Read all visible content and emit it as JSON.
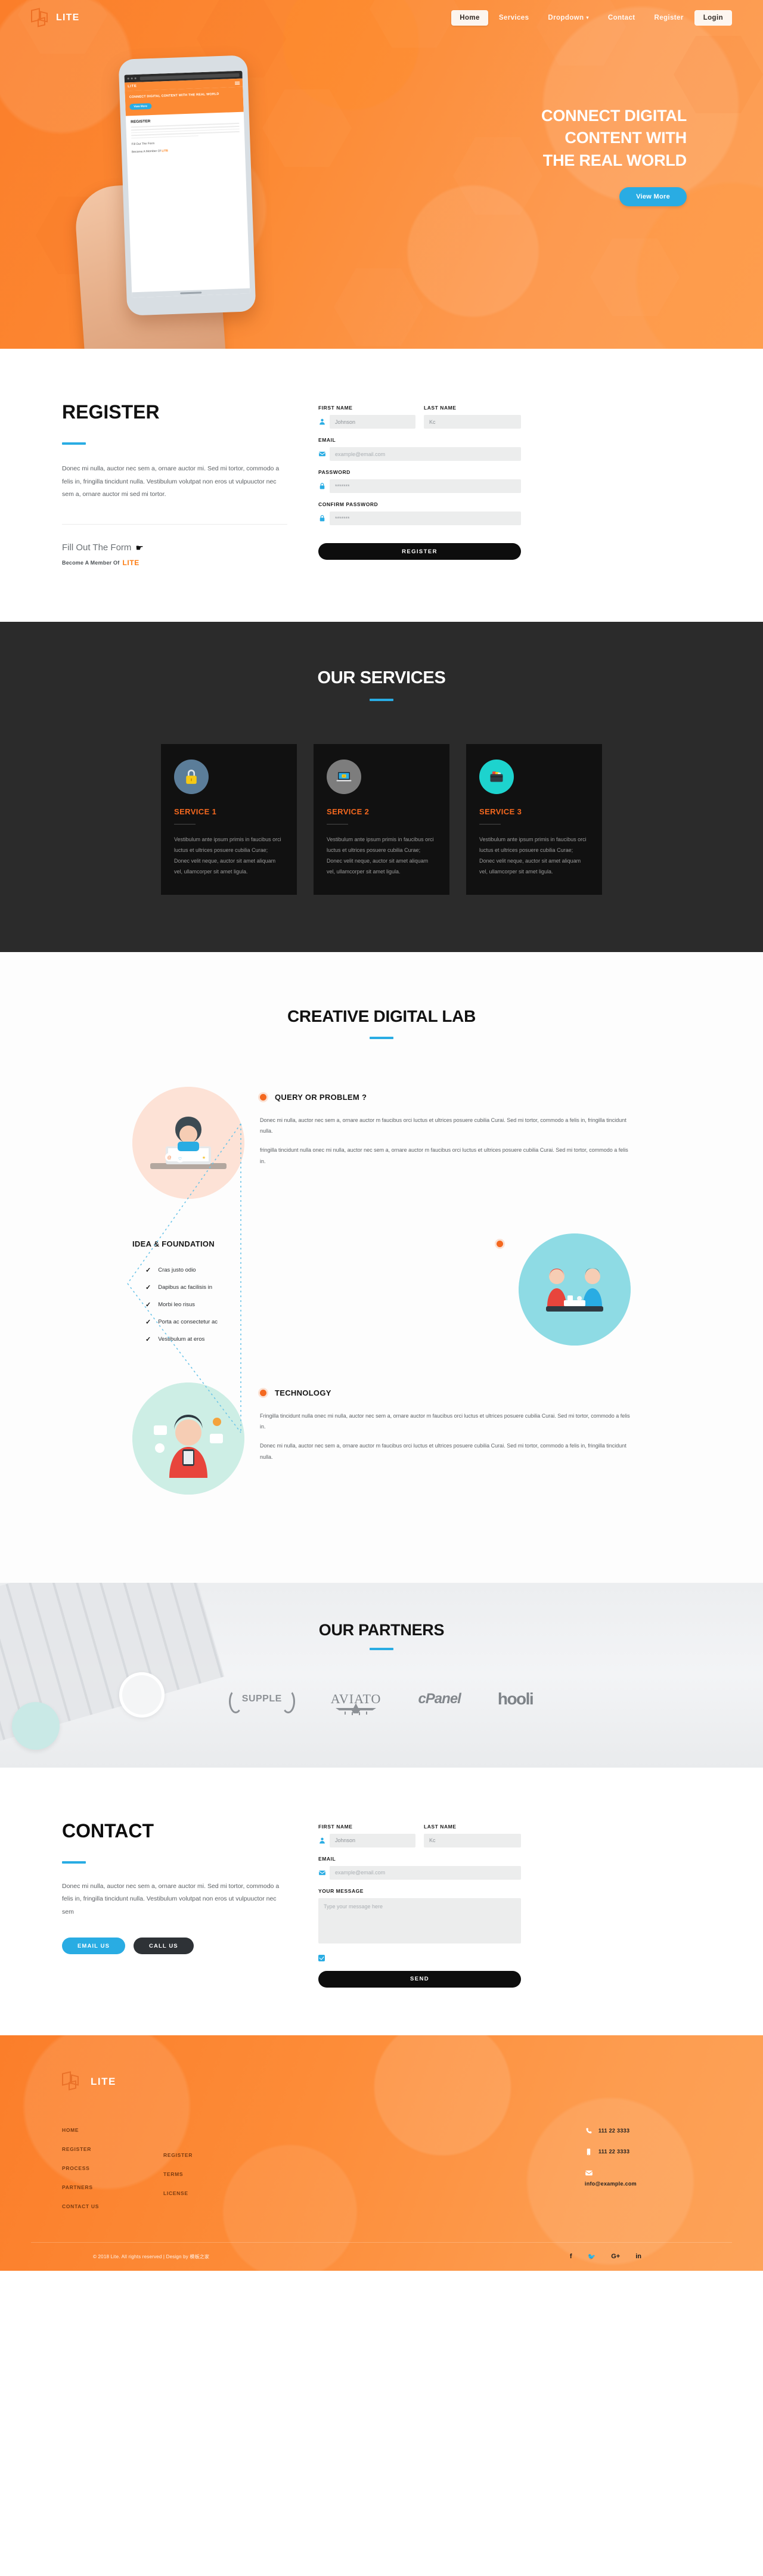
{
  "brand": {
    "name": "LITE",
    "logo_icon": "laravel-mark-icon"
  },
  "nav": {
    "items": [
      {
        "label": "Home",
        "active": true
      },
      {
        "label": "Services",
        "active": false
      },
      {
        "label": "Dropdown",
        "caret": "▾",
        "active": false
      },
      {
        "label": "Contact",
        "active": false
      },
      {
        "label": "Register",
        "active": false
      },
      {
        "label": "Login",
        "outline": true
      }
    ]
  },
  "hero": {
    "title_lines": [
      "CONNECT DIGITAL",
      "CONTENT WITH",
      "THE REAL WORLD"
    ],
    "button": "View More",
    "accent": "#29ace3",
    "background": "#fc8a34",
    "phone": {
      "logo": "LITE",
      "hero_text": "CONNECT DIGITAL CONTENT WITH THE REAL WORLD",
      "hero_button": "View More",
      "section_title": "REGISTER",
      "fill_text": "Fill Out The Form",
      "member_text": "Become A Member Of",
      "member_brand": "LITE"
    }
  },
  "register": {
    "title": "REGISTER",
    "paragraph": "Donec mi nulla, auctor nec sem a, ornare auctor mi. Sed mi tortor, commodo a felis in, fringilla tincidunt nulla. Vestibulum volutpat non eros ut vulpuuctor nec sem a, ornare auctor mi sed mi tortor.",
    "fill_out": "Fill Out The Form",
    "fill_icon": "pointing-hand-icon",
    "member_prefix": "Become A Member Of",
    "member_brand": "LITE",
    "fields": {
      "first_name_label": "FIRST NAME",
      "first_name_value": "Johnson",
      "last_name_label": "LAST NAME",
      "last_name_value": "Kc",
      "email_label": "EMAIL",
      "email_placeholder": "example@email.com",
      "password_label": "PASSWORD",
      "password_value": "*******",
      "confirm_label": "CONFIRM PASSWORD",
      "confirm_value": "*******"
    },
    "submit": "REGISTER"
  },
  "services": {
    "title": "OUR SERVICES",
    "cards": [
      {
        "icon": "padlock-icon",
        "icon_bg": "#5b7d99",
        "title": "SERVICE 1",
        "text": "Vestibulum ante ipsum primis in faucibus orci luctus et ultrices posuere cubilia Curae; Donec velit neque, auctor sit amet aliquam vel, ullamcorper sit amet ligula."
      },
      {
        "icon": "laptop-icon",
        "icon_bg": "#7d7d7d",
        "title": "SERVICE 2",
        "text": "Vestibulum ante ipsum primis in faucibus orci luctus et ultrices posuere cubilia Curae; Donec velit neque, auctor sit amet aliquam vel, ullamcorper sit amet ligula."
      },
      {
        "icon": "wallet-icon",
        "icon_bg": "#1dd3ce",
        "title": "SERVICE 3",
        "text": "Vestibulum ante ipsum primis in faucibus orci luctus et ultrices posuere cubilia Curae; Donec velit neque, auctor sit amet aliquam vel, ullamcorper sit amet ligula."
      }
    ]
  },
  "lab": {
    "title": "CREATIVE DIGITAL LAB",
    "blocks": [
      {
        "heading": "QUERY OR PROBLEM ?",
        "illustration": "woman-at-laptop-icon",
        "paragraphs": [
          "Donec mi nulla, auctor nec sem a, ornare auctor m faucibus orci luctus et ultrices posuere cubilia Curai. Sed mi tortor, commodo a felis in, fringilla tincidunt nulla.",
          "fringilla tincidunt nulla onec mi nulla, auctor nec sem a, ornare auctor m faucibus orci luctus et ultrices posuere cubilia Curai. Sed mi tortor, commodo a felis in."
        ]
      },
      {
        "heading": "IDEA & FOUNDATION",
        "illustration": "two-people-meeting-icon",
        "items": [
          "Cras justo odio",
          "Dapibus ac facilisis in",
          "Morbi leo risus",
          "Porta ac consectetur ac",
          "Vestibulum at eros"
        ]
      },
      {
        "heading": "TECHNOLOGY",
        "illustration": "woman-with-phone-icon",
        "paragraphs": [
          "Fringilla tincidunt nulla onec mi nulla, auctor nec sem a, ornare auctor m faucibus orci luctus et ultrices posuere cubilia Curai. Sed mi tortor, commodo a felis in.",
          "Donec mi nulla, auctor nec sem a, ornare auctor m faucibus orci luctus et ultrices posuere cubilia Curai. Sed mi tortor, commodo a felis in, fringilla tincidunt nulla."
        ]
      }
    ]
  },
  "partners": {
    "title": "OUR PARTNERS",
    "logos": [
      "SUPPLE",
      "AVIATO",
      "cPanel",
      "hooli"
    ]
  },
  "contact": {
    "title": "CONTACT",
    "paragraph": "Donec mi nulla, auctor nec sem a, ornare auctor mi. Sed mi tortor, commodo a felis in, fringilla tincidunt nulla. Vestibulum volutpat non eros ut vulpuuctor nec sem",
    "email_button": "EMAIL US",
    "call_button": "CALL US",
    "fields": {
      "first_name_label": "FIRST NAME",
      "first_name_value": "Johnson",
      "last_name_label": "LAST NAME",
      "last_name_value": "Kc",
      "email_label": "EMAIL",
      "email_placeholder": "example@email.com",
      "message_label": "YOUR MESSAGE",
      "message_placeholder": "Type your message here"
    },
    "submit": "SEND"
  },
  "footer": {
    "brand": "LITE",
    "col1": [
      "HOME",
      "REGISTER",
      "PROCESS",
      "PARTNERS",
      "CONTACT US"
    ],
    "col2": [
      "REGISTER",
      "TERMS",
      "LICENSE"
    ],
    "contact": [
      {
        "icon": "phone-icon",
        "value": "111 22 3333"
      },
      {
        "icon": "mobile-icon",
        "value": "111 22 3333"
      },
      {
        "icon": "envelope-icon",
        "value": "info@example.com"
      }
    ],
    "copyright": "© 2018 Lite. All rights reserved | Design by 模板之家",
    "socials": [
      {
        "icon": "facebook-icon",
        "glyph": "f"
      },
      {
        "icon": "twitter-icon",
        "glyph": "🐦"
      },
      {
        "icon": "google-plus-icon",
        "glyph": "G+"
      },
      {
        "icon": "linkedin-icon",
        "glyph": "in"
      }
    ]
  }
}
